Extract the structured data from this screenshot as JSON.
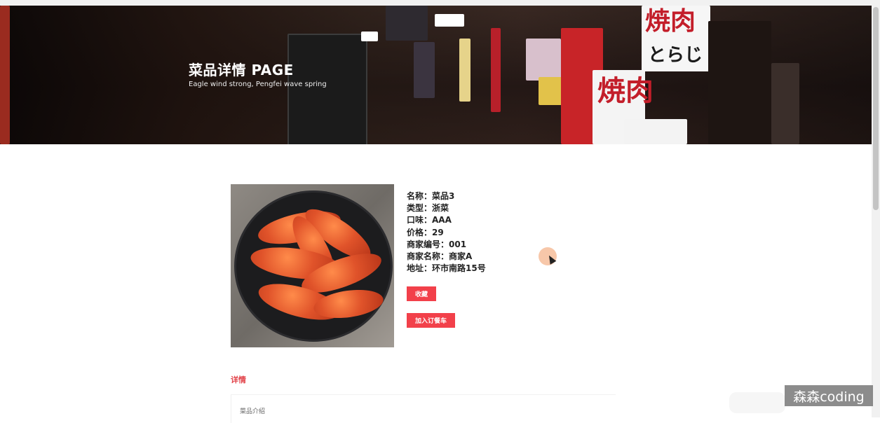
{
  "hero": {
    "title": "菜品详情 PAGE",
    "subtitle": "Eagle wind strong, Pengfei wave spring",
    "sign_text_1": "焼肉",
    "sign_text_2": "とらじ",
    "sign_text_3": "焼肉"
  },
  "dish": {
    "image_alt": "shrimp dish photo",
    "fields": [
      {
        "label": "名称：",
        "value": "菜品3"
      },
      {
        "label": "类型：",
        "value": "浙菜"
      },
      {
        "label": "口味：",
        "value": "AAA"
      },
      {
        "label": "价格：",
        "value": "29"
      },
      {
        "label": "商家编号：",
        "value": "001"
      },
      {
        "label": "商家名称：",
        "value": "商家A"
      },
      {
        "label": "地址：",
        "value": "环市南路15号"
      }
    ],
    "favorite_label": "收藏",
    "cart_label": "加入订餐车"
  },
  "details": {
    "section_title": "详情",
    "intro_text": "菜品介绍"
  },
  "watermark": "森森coding",
  "colors": {
    "accent": "#f2404a",
    "section_title": "#e2434a"
  }
}
